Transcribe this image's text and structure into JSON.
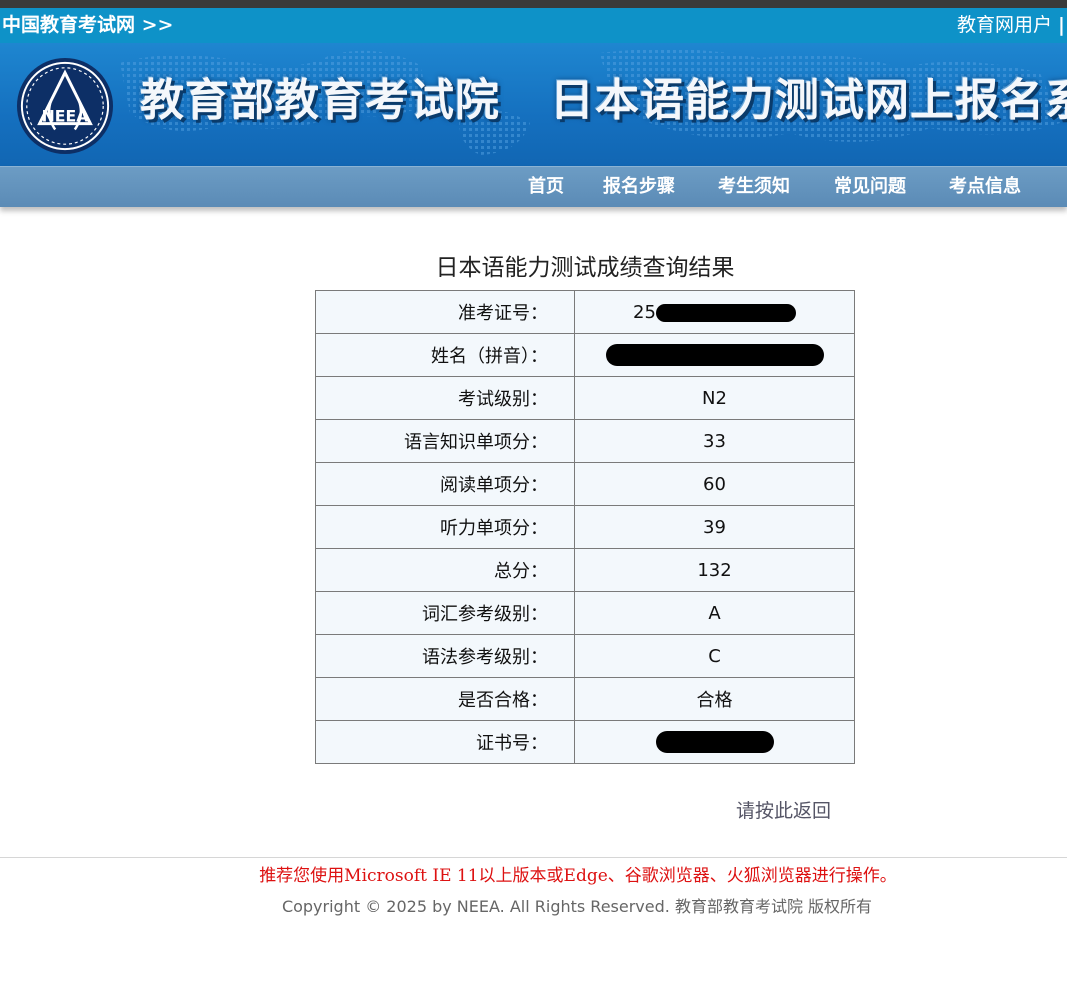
{
  "topbar": {
    "site_link": "中国教育考试网 >>",
    "user_label": "教育网用户",
    "separator": "|"
  },
  "banner": {
    "logo_text": "NEEA",
    "org_title": "教育部教育考试院",
    "system_title": "日本语能力测试网上报名系"
  },
  "nav": {
    "items": [
      "首页",
      "报名步骤",
      "考生须知",
      "常见问题",
      "考点信息"
    ]
  },
  "result": {
    "title": "日本语能力测试成绩查询结果",
    "rows": [
      {
        "label": "准考证号：",
        "value": "25"
      },
      {
        "label": "姓名（拼音）：",
        "value": ""
      },
      {
        "label": "考试级别：",
        "value": "N2"
      },
      {
        "label": "语言知识单项分：",
        "value": "33"
      },
      {
        "label": "阅读单项分：",
        "value": "60"
      },
      {
        "label": "听力单项分：",
        "value": "39"
      },
      {
        "label": "总分：",
        "value": "132"
      },
      {
        "label": "词汇参考级别：",
        "value": "A"
      },
      {
        "label": "语法参考级别：",
        "value": "C"
      },
      {
        "label": "是否合格：",
        "value": "合格"
      },
      {
        "label": "证书号：",
        "value": ""
      }
    ],
    "back_link": "请按此返回"
  },
  "footer": {
    "browser_note": "推荐您使用Microsoft IE 11以上版本或Edge、谷歌浏览器、火狐浏览器进行操作。",
    "copyright": "Copyright © 2025 by NEEA. All Rights Reserved. 教育部教育考试院 版权所有"
  },
  "colors": {
    "topbar": "#0e92c8",
    "banner": "#1570bf",
    "navbar": "#5b8bb6",
    "table_bg": "#f3f8fc",
    "warning_text": "#dd1111"
  }
}
